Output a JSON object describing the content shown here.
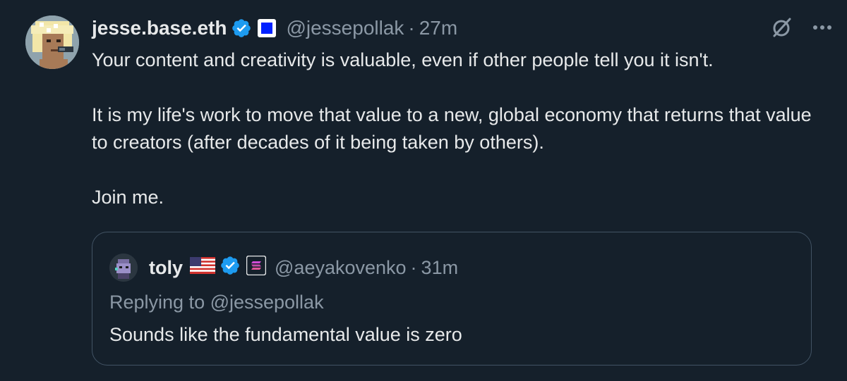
{
  "tweet": {
    "author_name": "jesse.base.eth",
    "handle": "@jessepollak",
    "separator": "·",
    "time": "27m",
    "paragraphs": [
      "Your content and creativity is valuable, even if other people tell you it isn't.",
      "It is my life's work to move that value to a new, global economy that returns that value to creators (after decades of it being taken by others).",
      "Join me."
    ],
    "actions": {
      "grok_icon": "grok-icon",
      "more_icon": "more-icon",
      "more_label": "···"
    }
  },
  "quote": {
    "author_name": "toly",
    "flag_icon": "us-flag-icon",
    "handle": "@aeyakovenko",
    "separator": "·",
    "time": "31m",
    "replying_to": "Replying to @jessepollak",
    "text": "Sounds like the fundamental value is zero"
  },
  "colors": {
    "background": "#15202b",
    "text": "#e7e9ea",
    "secondary": "#8b98a5",
    "verified": "#1d9bf0",
    "border": "#425364"
  }
}
